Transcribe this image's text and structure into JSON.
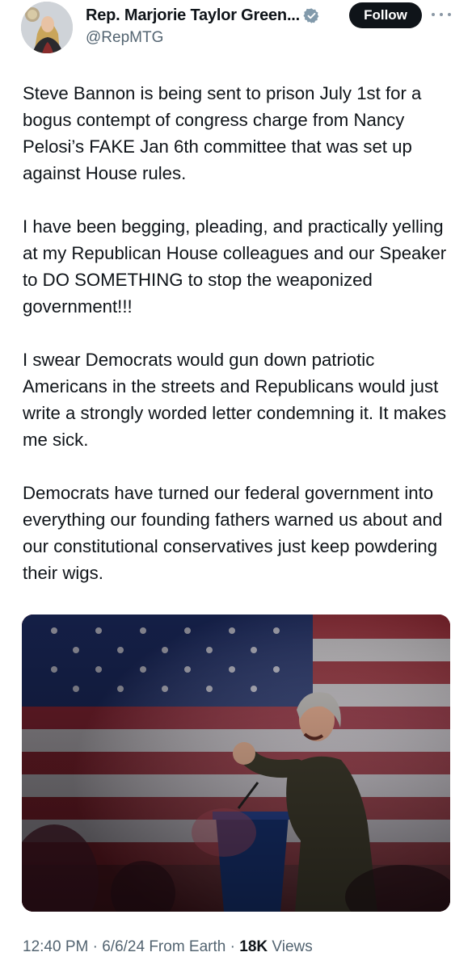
{
  "author": {
    "display_name": "Rep. Marjorie Taylor Green...",
    "handle": "@RepMTG",
    "verified_badge_color": "#829aab"
  },
  "header": {
    "follow_label": "Follow"
  },
  "tweet": {
    "paragraphs": [
      "Steve Bannon is being sent to prison July 1st for a bogus contempt of congress charge from Nancy Pelosi’s FAKE Jan 6th committee that was set up against House rules.",
      "I have been begging, pleading, and practically yelling at my Republican House colleagues and our Speaker to DO SOMETHING to stop the weaponized government!!!",
      " I swear Democrats would gun down patriotic Americans in the streets and Republicans would just write a strongly worded letter condemning it.  It makes me sick.",
      "Democrats have turned our federal government into everything our founding fathers warned us about and our constitutional conservatives just keep powdering their wigs."
    ]
  },
  "meta": {
    "time": "12:40 PM",
    "separator": "·",
    "date": "6/6/24",
    "source": "From Earth",
    "views_count": "18K",
    "views_label": "Views"
  },
  "colors": {
    "text": "#0f1419",
    "muted": "#536471",
    "button_bg": "#0f1419"
  },
  "icons": {
    "verified": "verified-badge-icon",
    "more": "more-options-icon"
  }
}
